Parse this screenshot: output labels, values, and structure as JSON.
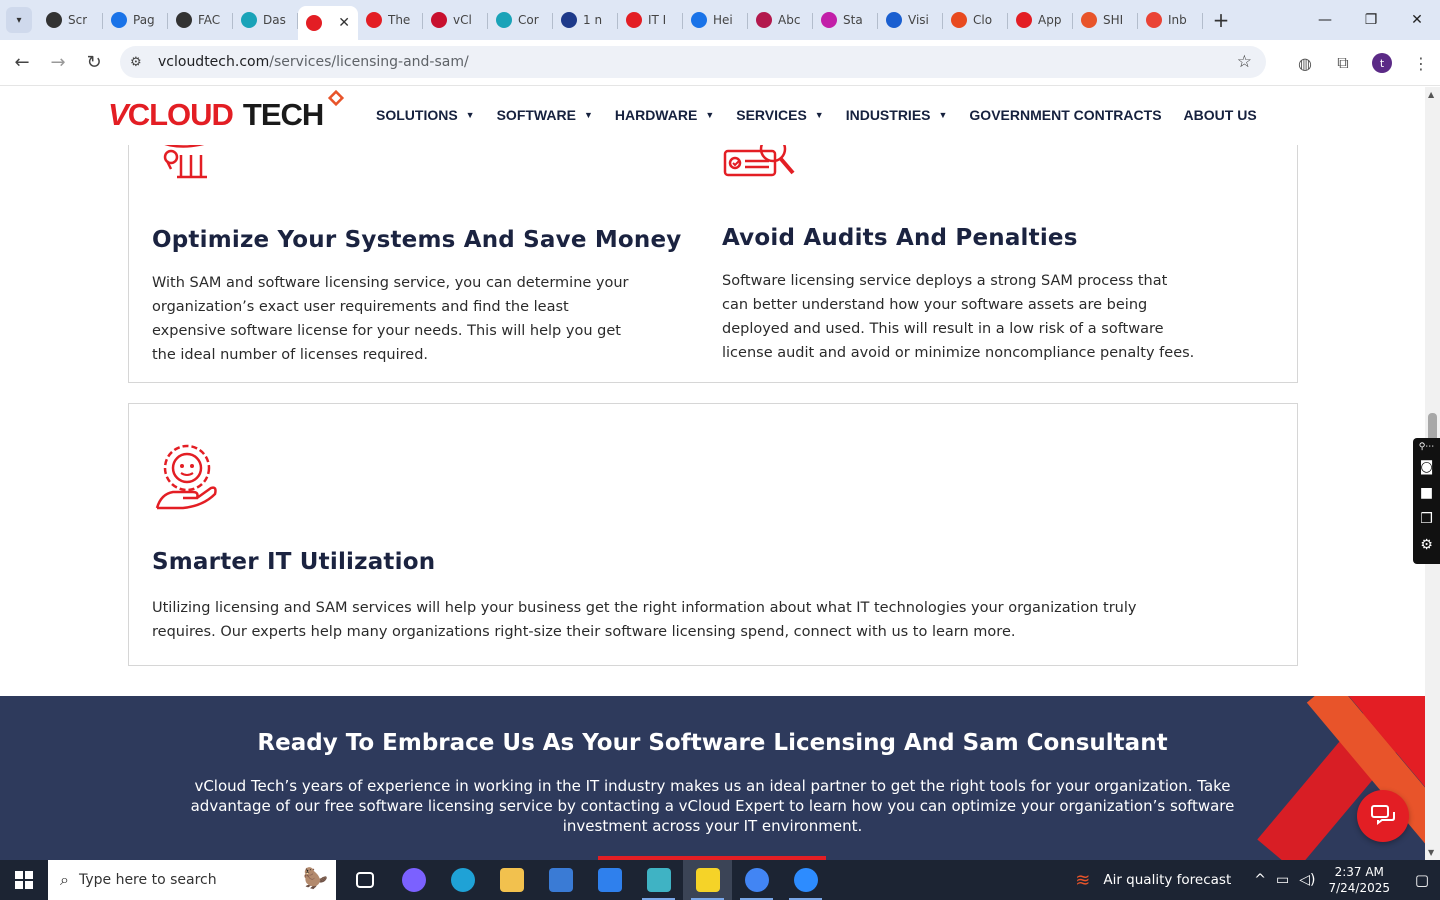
{
  "browser": {
    "tabs": [
      {
        "title": "Scr",
        "color": "#333333"
      },
      {
        "title": "Pag",
        "color": "#1a73e8"
      },
      {
        "title": "FAC",
        "color": "#333333"
      },
      {
        "title": "Das",
        "color": "#1aa3b8"
      },
      {
        "title": "",
        "color": "#e31e24",
        "active": true
      },
      {
        "title": "The",
        "color": "#e31e24"
      },
      {
        "title": "vCl",
        "color": "#c8102e"
      },
      {
        "title": "Cor",
        "color": "#1aa3b8"
      },
      {
        "title": "1 n",
        "color": "#1e3a8a"
      },
      {
        "title": "IT I",
        "color": "#e31e24"
      },
      {
        "title": "Hei",
        "color": "#1a73e8"
      },
      {
        "title": "Abc",
        "color": "#b3194d"
      },
      {
        "title": "Sta",
        "color": "#c21fa8"
      },
      {
        "title": "Visi",
        "color": "#1a5fd0"
      },
      {
        "title": "Clo",
        "color": "#e84a1f"
      },
      {
        "title": "App",
        "color": "#e31e24"
      },
      {
        "title": "SHI",
        "color": "#e8542a"
      },
      {
        "title": "Inb",
        "color": "#ea4335"
      }
    ],
    "active_tab_close": "✕",
    "new_tab": "+",
    "url_host": "vcloudtech.com",
    "url_path": "/services/licensing-and-sam/",
    "profile_initial": "t"
  },
  "site": {
    "logo": {
      "v": "V",
      "cloud": "CLOUD",
      "tech": "TECH"
    },
    "nav": [
      {
        "label": "SOLUTIONS",
        "caret": true
      },
      {
        "label": "SOFTWARE",
        "caret": true
      },
      {
        "label": "HARDWARE",
        "caret": true
      },
      {
        "label": "SERVICES",
        "caret": true
      },
      {
        "label": "INDUSTRIES",
        "caret": true
      },
      {
        "label": "GOVERNMENT CONTRACTS",
        "caret": false
      },
      {
        "label": "ABOUT US",
        "caret": false
      }
    ],
    "features": {
      "optimize": {
        "title": "Optimize Your Systems And Save Money",
        "lines": [
          "With SAM and software licensing service, you can determine your",
          "organization’s exact user requirements and find the least",
          "expensive software license for your needs. This will help you get",
          "the ideal number of licenses required."
        ]
      },
      "audits": {
        "title": "Avoid Audits And Penalties",
        "lines": [
          "Software licensing service deploys a strong SAM process that",
          "can better understand how your software assets are being",
          "deployed and used. This will result in a low risk of a software",
          "license audit and avoid or minimize noncompliance penalty fees."
        ]
      },
      "smarter": {
        "title": "Smarter IT Utilization",
        "lines": [
          "Utilizing licensing and SAM services will help your business get the right information about what IT technologies your organization truly",
          "requires. Our experts help many organizations right-size their software licensing spend, connect with us to learn more."
        ]
      }
    },
    "cta": {
      "title": "Ready To Embrace Us As Your Software Licensing And Sam Consultant",
      "lines": [
        "vCloud Tech’s years of experience in working in the IT industry makes us an ideal partner to get the right tools for your organization. Take",
        "advantage of our free software licensing service by contacting a vCloud Expert to learn how you can optimize your organization’s software",
        "investment across your IT environment."
      ]
    },
    "colors": {
      "brand_red": "#e31e24",
      "navy": "#2e3a5c"
    }
  },
  "taskbar": {
    "search_placeholder": "Type here to search",
    "weather": "Air quality forecast",
    "time": "2:37 AM",
    "date": "7/24/2025",
    "apps": [
      {
        "name": "task-view",
        "color": "#ffffff",
        "run": false
      },
      {
        "name": "copilot",
        "color": "#7b61ff",
        "run": false
      },
      {
        "name": "edge",
        "color": "#1fa2d6",
        "run": false
      },
      {
        "name": "file-explorer",
        "color": "#f2c14e",
        "run": false
      },
      {
        "name": "store",
        "color": "#3a7bd5",
        "run": false
      },
      {
        "name": "mail",
        "color": "#2f80ed",
        "run": false
      },
      {
        "name": "app-diamond",
        "color": "#3fb3c4",
        "run": true
      },
      {
        "name": "sticky-notes",
        "color": "#f5d328",
        "run": true,
        "sel": true
      },
      {
        "name": "chrome",
        "color": "#4285f4",
        "run": true
      },
      {
        "name": "zoom",
        "color": "#2d8cff",
        "run": true
      }
    ]
  }
}
